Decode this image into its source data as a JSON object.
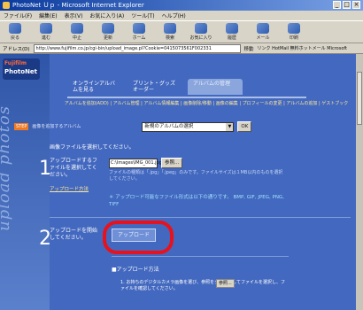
{
  "window": {
    "title": "PhotoNet Ｕｐ - Microsoft Internet Explorer"
  },
  "menu": [
    "ファイル(F)",
    "編集(E)",
    "表示(V)",
    "お気に入り(A)",
    "ツール(T)",
    "ヘルプ(H)"
  ],
  "toolbar": [
    {
      "label": "戻る",
      "icon": "back-icon"
    },
    {
      "label": "進む",
      "icon": "forward-icon"
    },
    {
      "label": "中止",
      "icon": "stop-icon"
    },
    {
      "label": "更新",
      "icon": "refresh-icon"
    },
    {
      "label": "ホーム",
      "icon": "home-icon"
    },
    {
      "label": "検索",
      "icon": "search-icon"
    },
    {
      "label": "お気に入り",
      "icon": "favorites-icon"
    },
    {
      "label": "履歴",
      "icon": "history-icon"
    },
    {
      "label": "メール",
      "icon": "mail-icon"
    },
    {
      "label": "印刷",
      "icon": "print-icon"
    }
  ],
  "address": {
    "label": "アドレス(D)",
    "url": "http://www.fujifilm.co.jp/cgi-bin/upload_image.pl?Cookie=0415073561F002331",
    "go_label": "移動",
    "links": "リンク  HotMail 無料ホットメール  Microsoft"
  },
  "page": {
    "logo_top": "Fujifilm",
    "logo_main": "PhotoNet",
    "vertical_text": "upload photos",
    "tabs": [
      "オンラインアルバムを見る",
      "プリント・グッズオーダー",
      "アルバムの管理"
    ],
    "subnav": "アルバムを追加(ADD)  |  アルバム管理  |  アルバム情報編集  |  画像削除/移動  |  画像の編集  |  プロフィールの変更  |  アルバムの追加  |  ゲストブック",
    "select_note": "STEP",
    "select_text": "画像を追加するアルバム",
    "select_value": "新規のアルバムの選択",
    "select_ok": "OK",
    "intro": "画像ファイルを選択してください。",
    "step1_num": "1",
    "step1_text": "アップロードするファイルを選択してください。",
    "file_value": "C:\\Images\\IMG_001.jpg",
    "browse_label": "参照...",
    "hint1": "ファイルの種類は「.jpg」「.jpeg」のみです。ファイルサイズは１MB以内のものを選択してください。",
    "step1_link": "アップロード方法",
    "hint2": "＊ アップロード可能なファイル形式は以下の通りです。 BMP, GIF, JPEG, PNG, TIFF",
    "step2_num": "2",
    "step2_text": "アップロードを開始してください。",
    "upload_label": "アップロード",
    "how_title": "■アップロード方法",
    "how_line": "1. お持ちのデジタルカメラ画像を選び、参照をクリックしてファイルを選択し、ファイルを確認してください。",
    "how_btn": "参照..."
  }
}
